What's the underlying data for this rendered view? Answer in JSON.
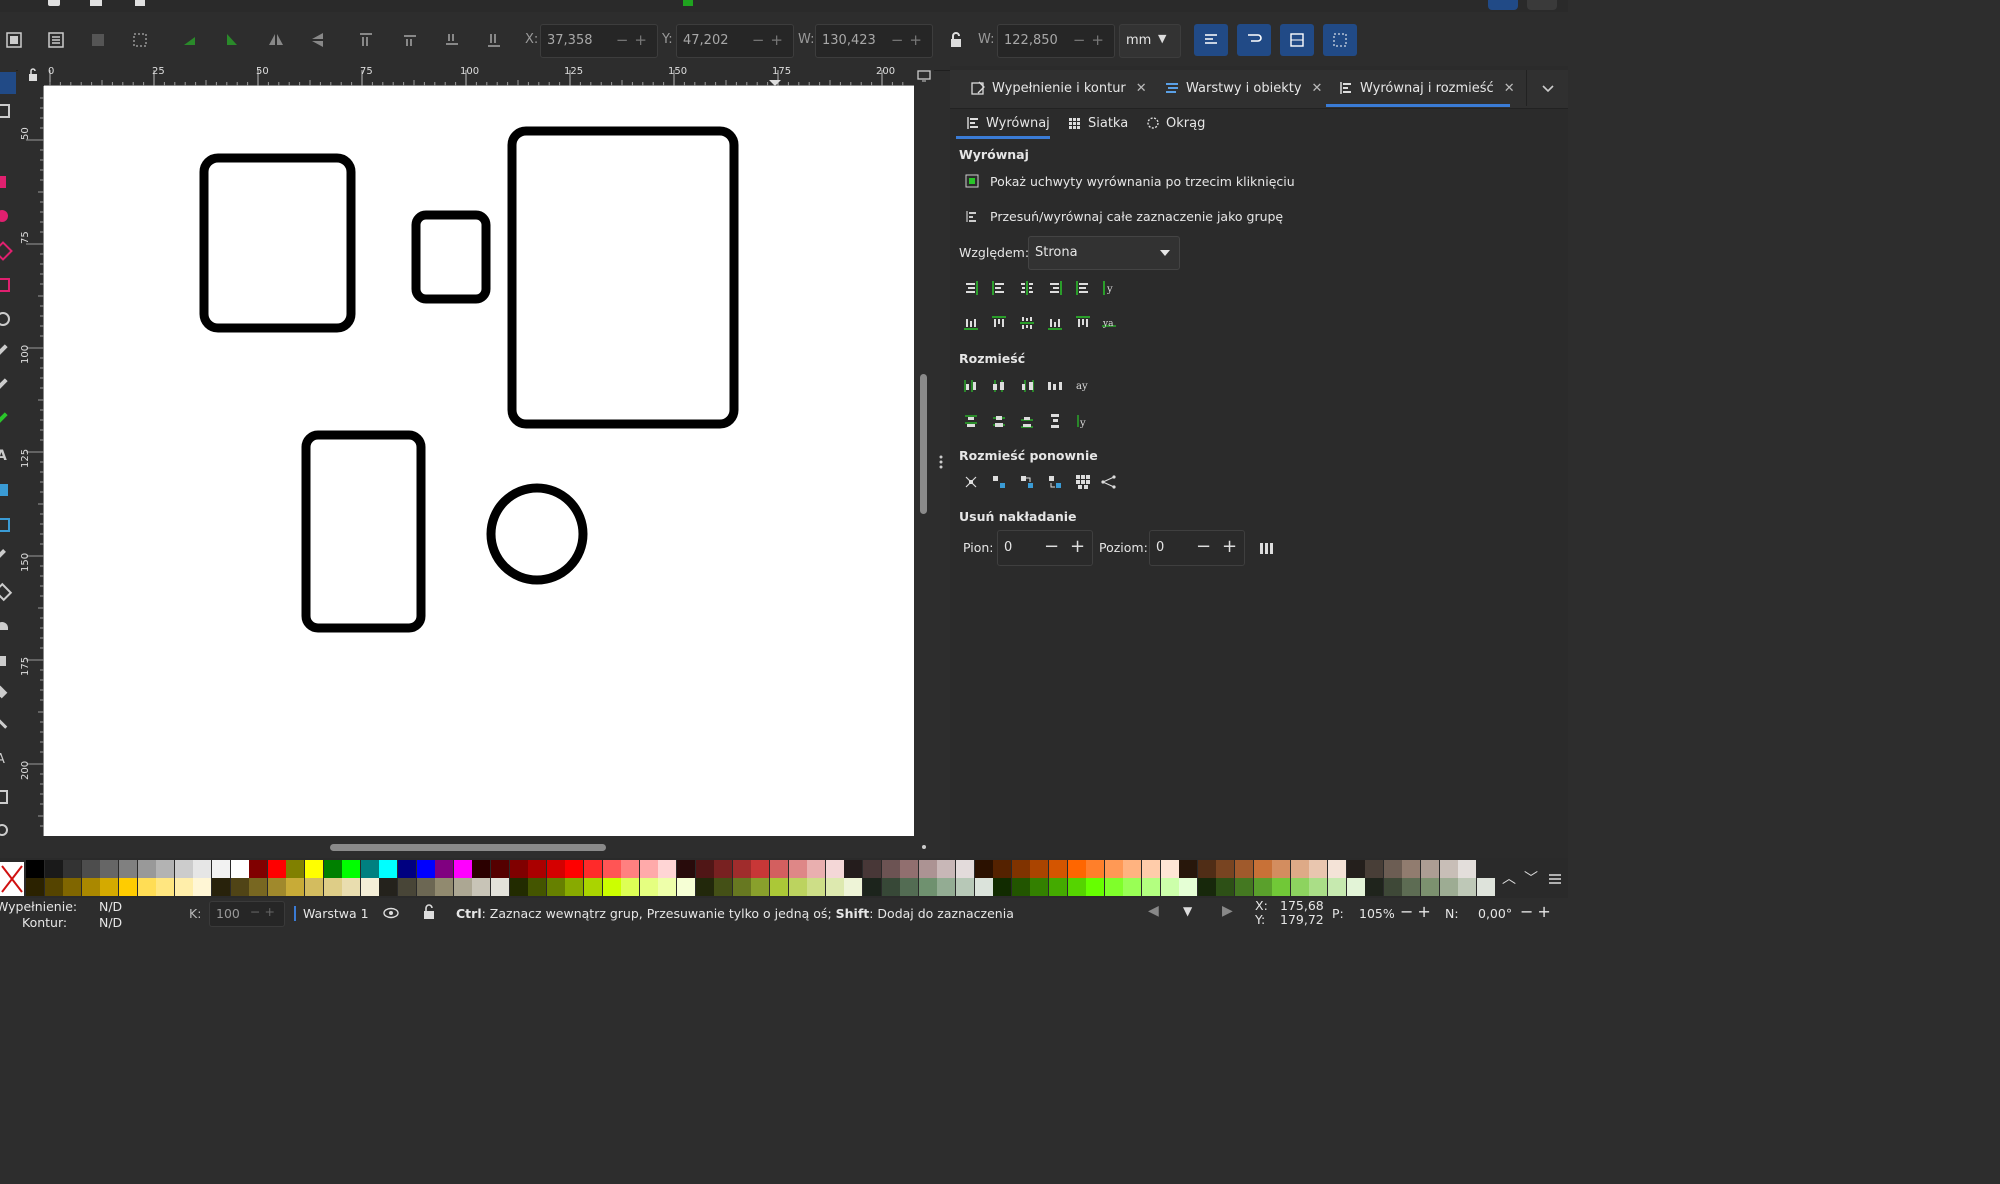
{
  "controls": {
    "x_label": "X:",
    "x_value": "37,358",
    "y_label": "Y:",
    "y_value": "47,202",
    "w_label": "W:",
    "w_value": "130,423",
    "h_label": "W:",
    "h_value": "122,850",
    "unit": "mm"
  },
  "ruler": {
    "top_ticks": [
      "0",
      "25",
      "50",
      "75",
      "100",
      "125",
      "150",
      "175",
      "200"
    ],
    "left_ticks": [
      "50",
      "75",
      "100",
      "125",
      "150",
      "175",
      "200"
    ]
  },
  "panel": {
    "tabs": [
      {
        "label": "Wypełnienie i kontur"
      },
      {
        "label": "Warstwy i obiekty"
      },
      {
        "label": "Wyrównaj i rozmieść"
      }
    ],
    "subtabs": [
      {
        "label": "Wyrównaj"
      },
      {
        "label": "Siatka"
      },
      {
        "label": "Okrąg"
      }
    ],
    "align_title": "Wyrównaj",
    "show_handles": "Pokaż uchwyty wyrównania po trzecim kliknięciu",
    "move_as_group": "Przesuń/wyrównaj całe zaznaczenie jako grupę",
    "relative_label": "Względem:",
    "relative_value": "Strona",
    "distribute_title": "Rozmieść",
    "redistribute_title": "Rozmieść ponownie",
    "remove_overlap_title": "Usuń nakładanie",
    "vertical_label": "Pion:",
    "vertical_value": "0",
    "horizontal_label": "Poziom:",
    "horizontal_value": "0"
  },
  "status": {
    "fill_label": "Wypełnienie:",
    "fill_value": "N/D",
    "stroke_label": "Kontur:",
    "stroke_value": "N/D",
    "opacity_label": "K:",
    "opacity_value": "100",
    "layer": "Warstwa 1",
    "hint_ctrl": "Ctrl",
    "hint_ctrl_text": ": Zaznacz wewnątrz grup, Przesuwanie tylko o jedną oś; ",
    "hint_shift": "Shift",
    "hint_shift_text": ": Dodaj do zaznaczenia",
    "coord_x_label": "X:",
    "coord_x": "175,68",
    "coord_y_label": "Y:",
    "coord_y": "179,72",
    "zoom_label": "P:",
    "zoom": "105%",
    "rotation_label": "N:",
    "rotation": "0,00°"
  },
  "colors": {
    "accent_blue": "#3a7bd5",
    "button_blue": "#214a86",
    "shape_stroke": "#000000",
    "canvas": "#ffffff"
  }
}
